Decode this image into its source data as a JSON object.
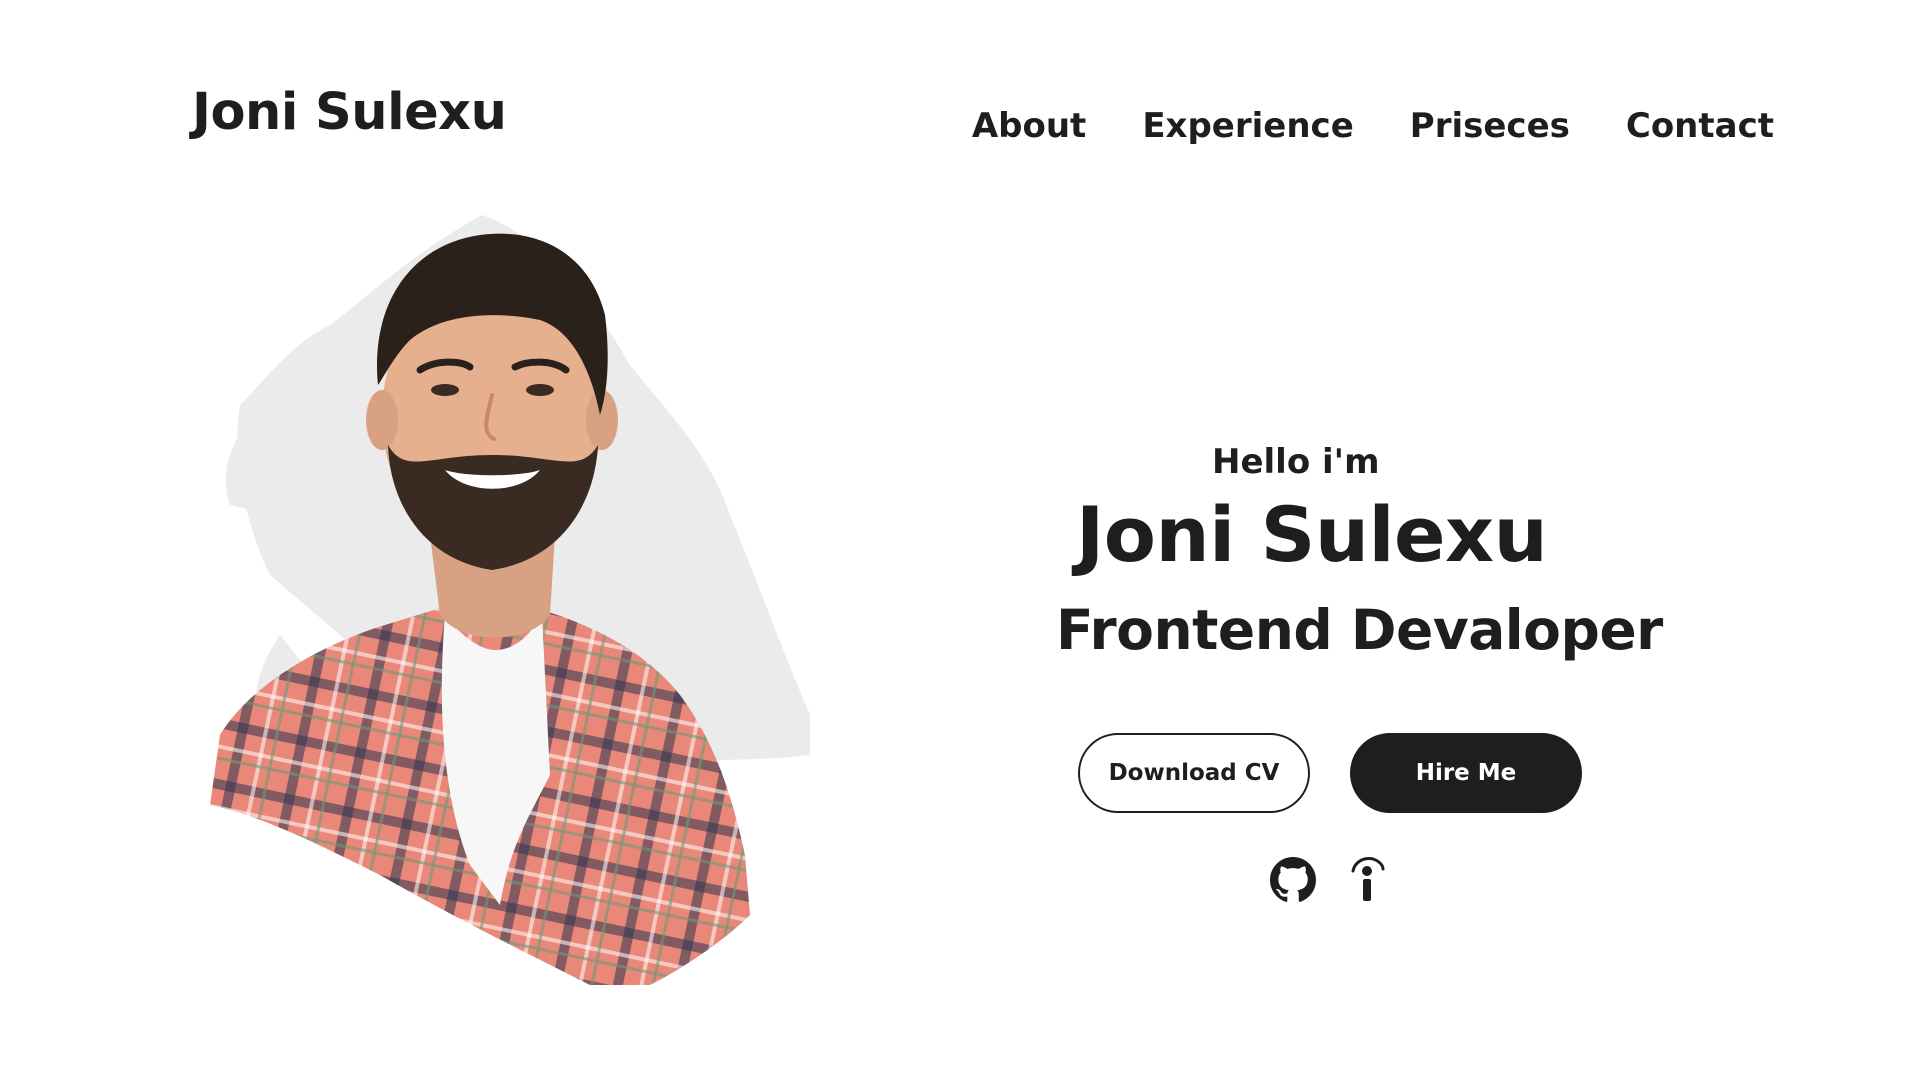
{
  "header": {
    "logo": "Joni Sulexu",
    "nav": [
      "About",
      "Experience",
      "Priseces",
      "Contact"
    ]
  },
  "hero": {
    "greeting": "Hello i'm",
    "name": "Joni Sulexu",
    "role": "Frontend Devaloper",
    "buttons": {
      "download_cv": "Download CV",
      "hire_me": "Hire Me"
    },
    "socials": [
      {
        "icon": "github-icon"
      },
      {
        "icon": "info-icon"
      }
    ]
  },
  "colors": {
    "text": "#1e1e1e",
    "background": "#ffffff",
    "brush": "#ebebeb",
    "shirt": "#e98878"
  }
}
